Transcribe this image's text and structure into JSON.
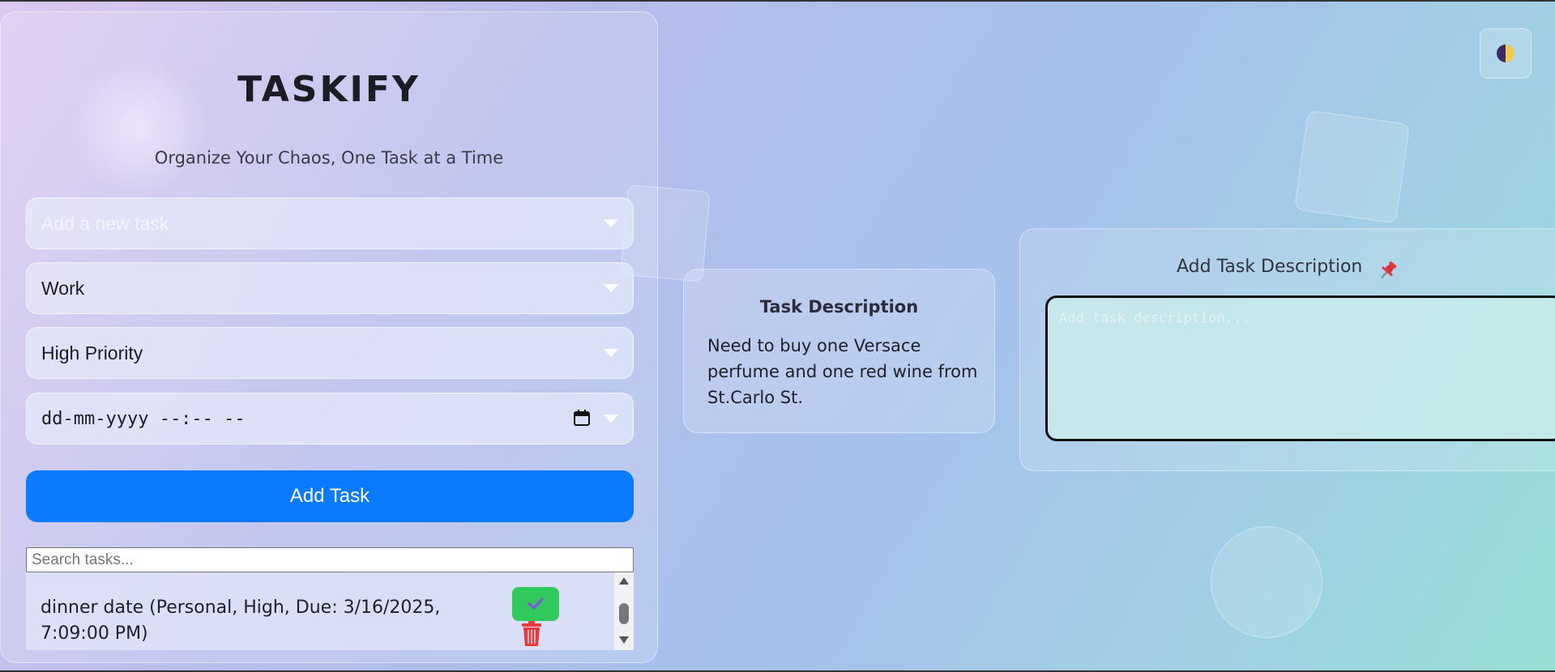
{
  "app": {
    "title": "TASKIFY",
    "subtitle": "Organize Your Chaos, One Task at a Time"
  },
  "form": {
    "task_placeholder": "Add a new task",
    "category_value": "Work",
    "priority_value": "High Priority",
    "datetime_placeholder": "dd-mm-yyyy --:-- --",
    "add_button_label": "Add Task",
    "search_placeholder": "Search tasks..."
  },
  "tasks": [
    {
      "text": "dinner date (Personal, High, Due: 3/16/2025, 7:09:00 PM)"
    }
  ],
  "description_card": {
    "title": "Task Description",
    "text": "Need to buy one Versace perfume and one red wine from St.Carlo St."
  },
  "add_description": {
    "title": "Add Task Description",
    "placeholder": "Add task description...",
    "pin_icon": "pushpin-icon"
  },
  "theme": {
    "toggle_icon": "half-moon-contrast-icon"
  },
  "colors": {
    "accent": "#0a7bff",
    "complete": "#32c95c",
    "delete": "#e8393f",
    "check": "#7b5bd6"
  }
}
